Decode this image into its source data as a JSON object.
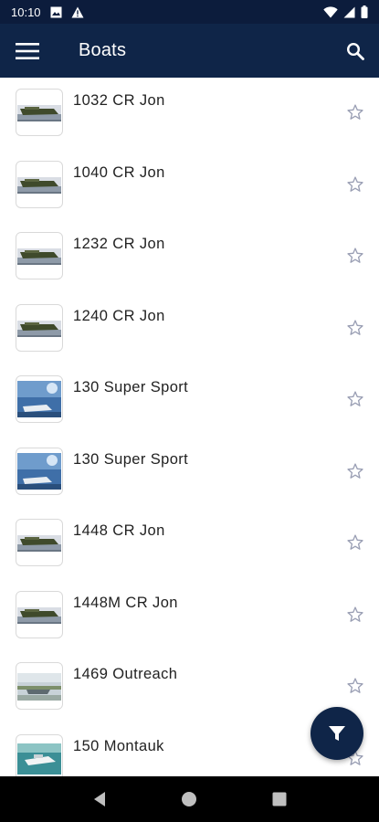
{
  "status_bar": {
    "time": "10:10",
    "left_icons": [
      "photo-icon",
      "warning-icon"
    ],
    "right_icons": [
      "wifi-icon",
      "signal-icon",
      "battery-icon"
    ]
  },
  "app_bar": {
    "title": "Boats",
    "menu_icon": "hamburger-menu-icon",
    "search_icon": "search-icon",
    "background": "#0f2548"
  },
  "boats": [
    {
      "name": "1032 CR Jon",
      "thumb": "jon",
      "favorite": false
    },
    {
      "name": "1040 CR Jon",
      "thumb": "jon",
      "favorite": false
    },
    {
      "name": "1232 CR Jon",
      "thumb": "jon",
      "favorite": false
    },
    {
      "name": "1240 CR Jon",
      "thumb": "jon",
      "favorite": false
    },
    {
      "name": "130 Super Sport",
      "thumb": "sport",
      "favorite": false
    },
    {
      "name": "130 Super Sport",
      "thumb": "sport",
      "favorite": false
    },
    {
      "name": "1448 CR Jon",
      "thumb": "jon",
      "favorite": false
    },
    {
      "name": "1448M CR Jon",
      "thumb": "jon",
      "favorite": false
    },
    {
      "name": "1469 Outreach",
      "thumb": "outreach",
      "favorite": false
    },
    {
      "name": "150 Montauk",
      "thumb": "montauk",
      "favorite": false
    }
  ],
  "fab": {
    "icon": "filter-icon"
  },
  "nav_bar": {
    "icons": [
      "back-icon",
      "home-icon",
      "recents-icon"
    ]
  }
}
